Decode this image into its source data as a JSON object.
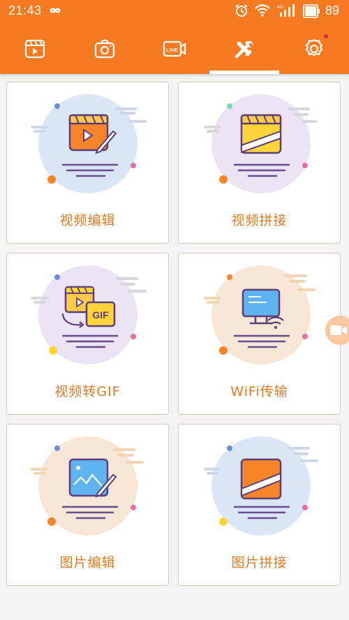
{
  "status_bar": {
    "time": "21:43",
    "battery_pct": "89",
    "network_label": "4G",
    "icons": [
      "infinity-icon",
      "alarm-icon",
      "wifi-icon",
      "signal-icon",
      "battery-icon"
    ]
  },
  "tabs": [
    {
      "icon": "video-clip-icon",
      "selected": false
    },
    {
      "icon": "camera-icon",
      "selected": false
    },
    {
      "icon": "live-icon",
      "label": "LIVE",
      "selected": false
    },
    {
      "icon": "tools-icon",
      "selected": true
    },
    {
      "icon": "settings-icon",
      "selected": false,
      "badge": true
    }
  ],
  "cards": [
    {
      "label": "视频编辑",
      "icon": "video-edit-icon",
      "circle": "#dbe7f7"
    },
    {
      "label": "视频拼接",
      "icon": "video-join-icon",
      "circle": "#ece4f5"
    },
    {
      "label": "视频转GIF",
      "icon": "video-to-gif-icon",
      "gif_text": "GIF",
      "circle": "#ece4f5"
    },
    {
      "label": "WiFi传输",
      "icon": "wifi-transfer-icon",
      "circle": "#f8e6d6"
    },
    {
      "label": "图片编辑",
      "icon": "image-edit-icon",
      "circle": "#f8e6d6"
    },
    {
      "label": "图片拼接",
      "icon": "image-join-icon",
      "circle": "#dbe7f7"
    }
  ],
  "colors": {
    "accent": "#f57a22",
    "label": "#e07b22",
    "card_border": "#dcc9b6",
    "background": "#f3f3f3"
  },
  "floating_button": {
    "icon": "video-camera-icon"
  }
}
